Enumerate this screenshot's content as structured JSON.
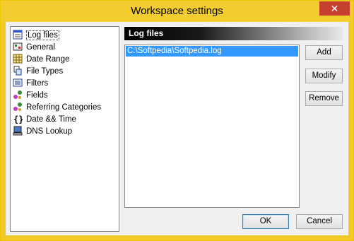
{
  "window": {
    "title": "Workspace settings",
    "close_glyph": "✕"
  },
  "nav": {
    "items": [
      {
        "label": "Log files",
        "icon": "log-files-icon",
        "selected": true
      },
      {
        "label": "General",
        "icon": "general-icon"
      },
      {
        "label": "Date Range",
        "icon": "calendar-icon"
      },
      {
        "label": "File Types",
        "icon": "file-types-icon"
      },
      {
        "label": "Filters",
        "icon": "filters-icon"
      },
      {
        "label": "Fields",
        "icon": "fields-icon"
      },
      {
        "label": "Referring Categories",
        "icon": "referring-categories-icon"
      },
      {
        "label": "Date && Time",
        "icon": "braces-icon"
      },
      {
        "label": "DNS Lookup",
        "icon": "computer-icon"
      }
    ]
  },
  "panel": {
    "title": "Log files",
    "files": [
      "C:\\Softpedia\\Softpedia.log"
    ],
    "add_label": "Add",
    "modify_label": "Modify",
    "remove_label": "Remove"
  },
  "footer": {
    "ok_label": "OK",
    "cancel_label": "Cancel"
  },
  "colors": {
    "titlebar": "#f3cc2f",
    "selection": "#3399ff",
    "close": "#c7402f"
  }
}
